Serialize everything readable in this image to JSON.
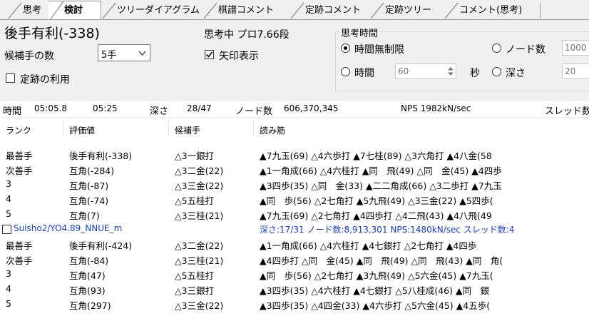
{
  "tabs": [
    {
      "label": "思考"
    },
    {
      "label": "検討"
    },
    {
      "label": "ツリーダイアグラム"
    },
    {
      "label": "棋譜コメント"
    },
    {
      "label": "定跡コメント"
    },
    {
      "label": "定跡ツリー"
    },
    {
      "label": "コメント(思考)"
    }
  ],
  "eval_header": "後手有利(-338)",
  "thinking_label": "思考中 プロ7.66段",
  "candidates": {
    "label": "候補手の数",
    "value": "5手"
  },
  "arrow_display": {
    "label": "矢印表示",
    "checked": true
  },
  "use_joseki": {
    "label": "定跡の利用",
    "checked": false
  },
  "think_time": {
    "group_label": "思考時間",
    "unlimited": "時間無制限",
    "nodes": "ノード数",
    "nodes_value": "1000",
    "time": "時間",
    "time_value": "60",
    "sec": "秒",
    "depth": "深さ",
    "depth_value": "20"
  },
  "status": {
    "time_label": "時間",
    "time_value": "05:05.8",
    "time_value2": "05:25",
    "depth_label": "深さ",
    "depth_value": "28/47",
    "nodes_label": "ノード数",
    "nodes_value": "606,370,345",
    "nps": "NPS 1982kN/sec",
    "threads": "スレッド数"
  },
  "columns": [
    "ランク",
    "評価値",
    "候補手",
    "読み筋"
  ],
  "engine1_rows": [
    {
      "rank": "最善手",
      "eval": "後手有利(-338)",
      "move": "△3一銀打",
      "pv": "▲7九玉(69) △4六歩打 ▲7七桂(89) △3六角打 ▲4八金(58"
    },
    {
      "rank": "次善手",
      "eval": "互角(-284)",
      "move": "△3二金(22)",
      "pv": "▲1一角成(66) △4六桂打 ▲同　飛(49) △同　金(45) ▲4四歩"
    },
    {
      "rank": "3",
      "eval": "互角(-87)",
      "move": "△3三金(22)",
      "pv": "▲3四歩(35) △同　金(33) ▲二二角成(66) △3二歩打 ▲7九玉"
    },
    {
      "rank": "4",
      "eval": "互角(-74)",
      "move": "△5五桂打",
      "pv": "▲同　歩(56) △2七角打 ▲5九飛(49) △3三金(22) ▲5四歩("
    },
    {
      "rank": "5",
      "eval": "互角(7)",
      "move": "△3三桂(21)",
      "pv": "▲7九玉(69) △2七角打 ▲4四歩打 △4二飛(43) ▲4八飛(49"
    }
  ],
  "engine2": {
    "name": "Suisho2/YO4.89_NNUE_m",
    "stats": "深さ:17/31 ノード数:8,913,301 NPS:1480kN/sec スレッド数:4"
  },
  "engine2_rows": [
    {
      "rank": "最善手",
      "eval": "後手有利(-424)",
      "move": "△3二金(22)",
      "pv": "▲1一角成(66) △4六桂打 ▲4七銀打 △2七角打 ▲4四歩"
    },
    {
      "rank": "次善手",
      "eval": "互角(-84)",
      "move": "△3三桂(21)",
      "pv": "▲4四歩打 △同　金(45) ▲同　飛(49) △同　飛(43) ▲同　角("
    },
    {
      "rank": "3",
      "eval": "互角(47)",
      "move": "△5五桂打",
      "pv": "▲同　歩(56) △2七角打 ▲3九飛(49) △5六金(45) ▲7九玉("
    },
    {
      "rank": "4",
      "eval": "互角(93)",
      "move": "△3三銀打",
      "pv": "▲3四歩(35) △4六桂打 ▲4七銀打 △5八桂成(46) ▲同　銀"
    },
    {
      "rank": "5",
      "eval": "互角(297)",
      "move": "△3三金(22)",
      "pv": "▲3四歩(35) △4四金(33) ▲4六歩打 △5六金(45) ▲4五歩("
    }
  ]
}
